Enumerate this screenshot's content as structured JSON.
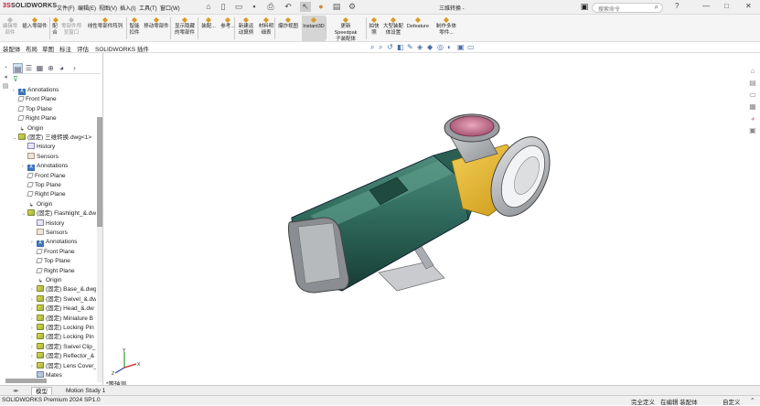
{
  "app": {
    "logo_ds": "3S",
    "logo_name": "SOLIDWORKS",
    "document_title": "三维转换 -",
    "search_placeholder": "搜索命令"
  },
  "menu": [
    "文件(F)",
    "编辑(E)",
    "视图(V)",
    "插入(I)",
    "工具(T)",
    "窗口(W)"
  ],
  "command_manager": {
    "buttons": [
      {
        "label": "编辑零\n部件",
        "icon": "edit-component-icon",
        "dim": true
      },
      {
        "label": "插入零部件",
        "icon": "insert-component-icon"
      },
      {
        "label": "配\n合",
        "icon": "mate-icon"
      },
      {
        "label": "零部件预\n览窗口",
        "icon": "component-preview-icon",
        "dim": true
      },
      {
        "label": "线性零部件阵列",
        "icon": "linear-pattern-icon"
      },
      {
        "label": "智能\n扣件",
        "icon": "smart-fasteners-icon"
      },
      {
        "label": "移动零部件",
        "icon": "move-component-icon"
      },
      {
        "label": "显示隐藏\n的零部件",
        "icon": "show-hidden-icon"
      },
      {
        "label": "装配...",
        "icon": "assembly-features-icon"
      },
      {
        "label": "参考...",
        "icon": "reference-geometry-icon"
      },
      {
        "label": "新建运\n动算例",
        "icon": "new-motion-study-icon"
      },
      {
        "label": "材料明\n细表",
        "icon": "bom-icon"
      },
      {
        "label": "爆炸视图",
        "icon": "exploded-view-icon"
      },
      {
        "label": "Instant3D",
        "icon": "instant3d-icon",
        "active": true
      },
      {
        "label": "更新\nSpeedpak\n子装配体",
        "icon": "speedpak-icon"
      },
      {
        "label": "拍快\n照",
        "icon": "snapshot-icon"
      },
      {
        "label": "大型装配\n体设置",
        "icon": "large-assembly-icon"
      },
      {
        "label": "Defeature",
        "icon": "defeature-icon"
      },
      {
        "label": "制作多体\n零件...",
        "icon": "make-multibody-icon"
      }
    ]
  },
  "tabs": [
    "装配体",
    "布局",
    "草图",
    "标注",
    "评估",
    "SOLIDWORKS 插件"
  ],
  "tree": [
    {
      "label": "Annotations",
      "icon": "ann",
      "level": 1,
      "tw": "›"
    },
    {
      "label": "Front Plane",
      "icon": "plane",
      "level": 1
    },
    {
      "label": "Top Plane",
      "icon": "plane",
      "level": 1
    },
    {
      "label": "Right Plane",
      "icon": "plane",
      "level": 1
    },
    {
      "label": "Origin",
      "icon": "origin",
      "level": 1
    },
    {
      "label": "(固定) 三维转换.dwg<1>",
      "icon": "part",
      "level": 1,
      "tw": "⌄"
    },
    {
      "label": "History",
      "icon": "hist",
      "level": 2
    },
    {
      "label": "Sensors",
      "icon": "sens",
      "level": 2
    },
    {
      "label": "Annotations",
      "icon": "ann",
      "level": 2,
      "tw": "›"
    },
    {
      "label": "Front Plane",
      "icon": "plane",
      "level": 2
    },
    {
      "label": "Top Plane",
      "icon": "plane",
      "level": 2
    },
    {
      "label": "Right Plane",
      "icon": "plane",
      "level": 2
    },
    {
      "label": "Origin",
      "icon": "origin",
      "level": 2
    },
    {
      "label": "(固定) Flashlight_&.dw",
      "icon": "part",
      "level": 2,
      "tw": "⌄"
    },
    {
      "label": "History",
      "icon": "hist",
      "level": 3
    },
    {
      "label": "Sensors",
      "icon": "sens",
      "level": 3
    },
    {
      "label": "Annotations",
      "icon": "ann",
      "level": 3,
      "tw": "›"
    },
    {
      "label": "Front Plane",
      "icon": "plane",
      "level": 3
    },
    {
      "label": "Top Plane",
      "icon": "plane",
      "level": 3
    },
    {
      "label": "Right Plane",
      "icon": "plane",
      "level": 3
    },
    {
      "label": "Origin",
      "icon": "origin",
      "level": 3
    },
    {
      "label": "(固定) Base_&.dwg",
      "icon": "part",
      "level": 3,
      "tw": "›"
    },
    {
      "label": "(固定) Swivel_&.dw",
      "icon": "part",
      "level": 3,
      "tw": "›"
    },
    {
      "label": "(固定) Head_&.dw",
      "icon": "part",
      "level": 3,
      "tw": "›"
    },
    {
      "label": "(固定) Miniature B",
      "icon": "part",
      "level": 3,
      "tw": "›"
    },
    {
      "label": "(固定) Locking Pin",
      "icon": "part",
      "level": 3,
      "tw": "›"
    },
    {
      "label": "(固定) Locking Pin",
      "icon": "part",
      "level": 3,
      "tw": "›"
    },
    {
      "label": "(固定) Swivel Clip_",
      "icon": "part",
      "level": 3,
      "tw": "›"
    },
    {
      "label": "(固定) Reflector_&",
      "icon": "part",
      "level": 3,
      "tw": "›"
    },
    {
      "label": "(固定) Lens Cover_",
      "icon": "part",
      "level": 3,
      "tw": "›"
    },
    {
      "label": "Mates",
      "icon": "folder",
      "level": 3
    }
  ],
  "viewport": {
    "view_label": "*等轴测",
    "triad": {
      "x": "X",
      "y": "Y",
      "z": "Z"
    },
    "colors": {
      "body": "#2f6a5c",
      "band": "#e6b52a",
      "lens": "#c86f8c",
      "metal": "#b9bcc0"
    }
  },
  "bottom_tabs": [
    "模型",
    "Motion Study 1"
  ],
  "status": {
    "product": "SOLIDWORKS Premium 2024 SP1.0",
    "defined": "完全定义",
    "editing": "在编辑 装配体",
    "custom": "自定义"
  }
}
